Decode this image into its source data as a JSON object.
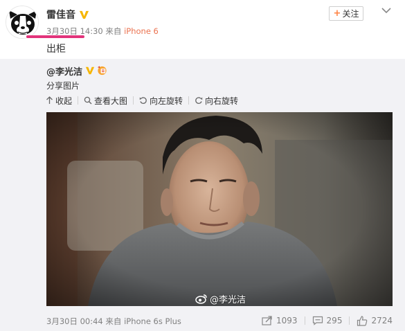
{
  "post": {
    "author": "雷佳音",
    "date": "3月30日",
    "time": "14:30",
    "via_prefix": "来自",
    "device": "iPhone 6",
    "text": "出柜"
  },
  "header": {
    "follow_label": "关注",
    "follow_plus": "+"
  },
  "repost": {
    "author_prefix": "@",
    "author": "李光洁",
    "content": "分享图片",
    "tools": [
      {
        "icon": "collapse-arrow-icon",
        "label": "收起"
      },
      {
        "icon": "magnifier-icon",
        "label": "查看大图"
      },
      {
        "icon": "rotate-left-icon",
        "label": "向左旋转"
      },
      {
        "icon": "rotate-right-icon",
        "label": "向右旋转"
      }
    ],
    "watermark": "@李光洁",
    "meta": {
      "date": "3月30日",
      "time": "00:44",
      "via_prefix": "来自",
      "device": "iPhone 6s Plus"
    },
    "stats": {
      "reposts": "1093",
      "comments": "295",
      "likes": "2724"
    }
  },
  "colors": {
    "verified_badge": "#f6b600",
    "link_orange": "#eb7350",
    "annotation_underline": "#e2347b",
    "repost_background": "#f2f2f5"
  }
}
